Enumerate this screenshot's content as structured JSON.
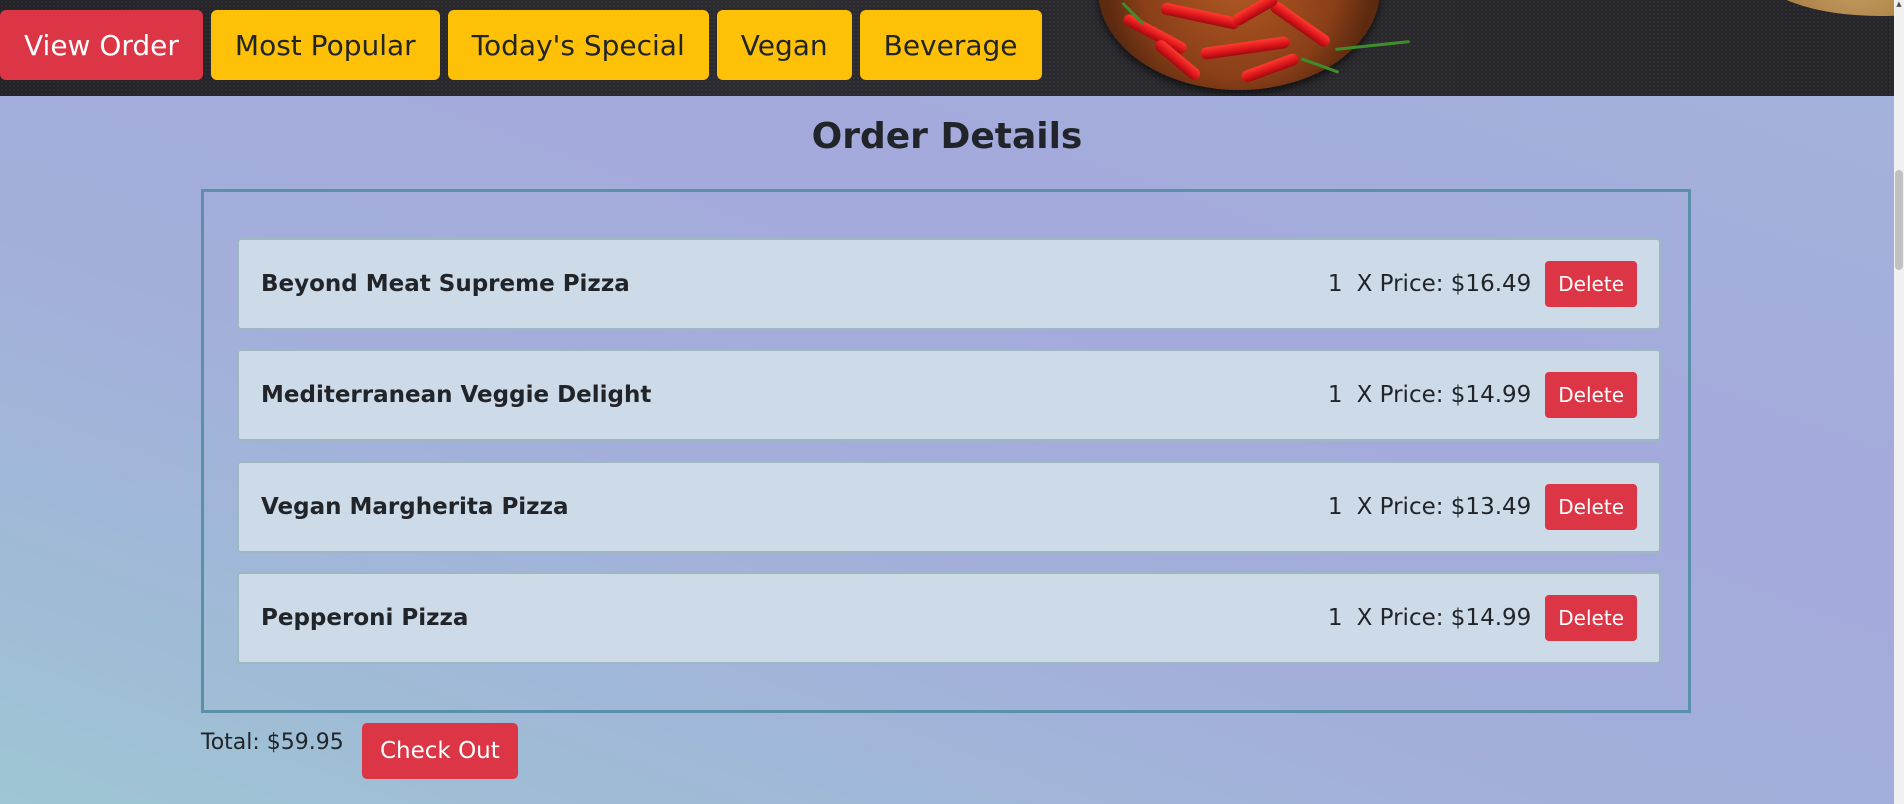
{
  "nav": {
    "view_order": "View Order",
    "most_popular": "Most Popular",
    "todays_special": "Today's Special",
    "vegan": "Vegan",
    "beverage": "Beverage"
  },
  "page": {
    "title": "Order Details"
  },
  "order": {
    "items": [
      {
        "name": "Beyond Meat Supreme Pizza",
        "qty": "1",
        "price": "X Price: $16.49",
        "delete_label": "Delete"
      },
      {
        "name": "Mediterranean Veggie Delight",
        "qty": "1",
        "price": "X Price: $14.99",
        "delete_label": "Delete"
      },
      {
        "name": "Vegan Margherita Pizza",
        "qty": "1",
        "price": "X Price: $13.49",
        "delete_label": "Delete"
      },
      {
        "name": "Pepperoni Pizza",
        "qty": "1",
        "price": "X Price: $14.99",
        "delete_label": "Delete"
      }
    ],
    "total": "Total: $59.95",
    "checkout_label": "Check Out"
  },
  "colors": {
    "danger": "#dc3545",
    "warning": "#ffc107",
    "item_bg": "#cddae8",
    "box_border": "#5a90a9"
  },
  "icons": {
    "scroll_up": "scroll-up-arrow-icon"
  }
}
